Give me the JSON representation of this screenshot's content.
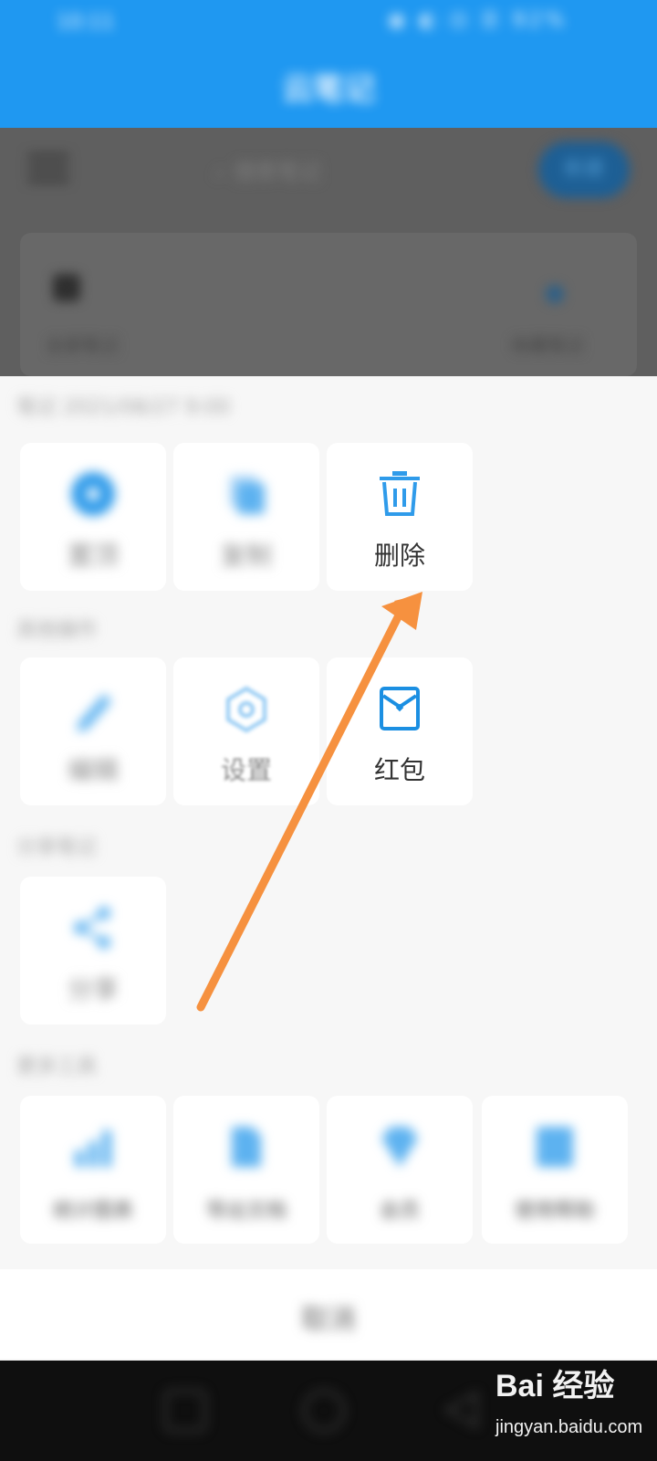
{
  "status_bar": {
    "time": "10:11",
    "right": "◉ ◐ ⊡ ☰ 92%"
  },
  "header": {
    "title": "云笔记"
  },
  "background": {
    "search_placeholder": "搜索笔记",
    "action_label": "新建",
    "card_left_label": "全部笔记",
    "card_right_label": "收藏笔记"
  },
  "sheet": {
    "section1": {
      "title": "笔记 2021/08/27 9:00",
      "items": [
        {
          "label": "置顶",
          "icon": "pin-icon"
        },
        {
          "label": "复制",
          "icon": "copy-icon"
        },
        {
          "label": "删除",
          "icon": "trash-icon"
        }
      ]
    },
    "section2": {
      "title": "其他操作",
      "items": [
        {
          "label": "编辑",
          "icon": "pencil-icon"
        },
        {
          "label": "设置",
          "icon": "hex-gear-icon"
        },
        {
          "label": "红包",
          "icon": "red-envelope-icon"
        }
      ]
    },
    "section3": {
      "title": "分享笔记",
      "items": [
        {
          "label": "分享",
          "icon": "share-icon"
        }
      ]
    },
    "section4": {
      "title": "更多工具",
      "items": [
        {
          "label": "统计图表",
          "icon": "chart-icon"
        },
        {
          "label": "导出文档",
          "icon": "document-icon"
        },
        {
          "label": "会员",
          "icon": "diamond-icon"
        },
        {
          "label": "使用帮助",
          "icon": "book-icon"
        }
      ]
    },
    "cancel_label": "取消"
  },
  "watermark": {
    "brand": "Bai 经验",
    "site": "jingyan.baidu.com"
  },
  "colors": {
    "primary": "#1f98f1",
    "icon_blue": "#2f9bea",
    "arrow_orange": "#f6913f"
  }
}
